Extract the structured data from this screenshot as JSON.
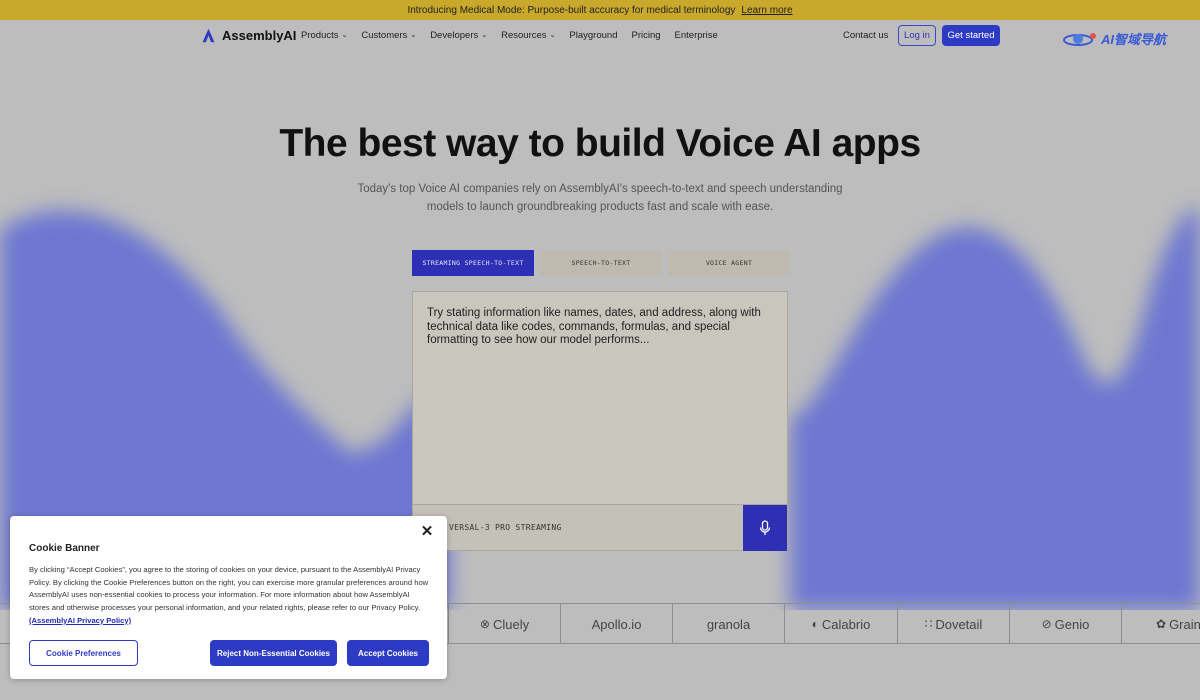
{
  "announcement": {
    "text": "Introducing Medical Mode: Purpose-built accuracy for medical terminology",
    "link": "Learn more"
  },
  "nav": {
    "brand": "AssemblyAI",
    "links": [
      "Products",
      "Customers",
      "Developers",
      "Resources",
      "Playground",
      "Pricing",
      "Enterprise"
    ],
    "contact": "Contact us",
    "login": "Log in",
    "cta": "Get started",
    "badge": "AI智域导航"
  },
  "hero": {
    "title": "The best way to build Voice AI apps",
    "subtitle_line1": "Today's top Voice AI companies rely on AssemblyAI's speech-to-text and speech understanding",
    "subtitle_line2": "models to launch groundbreaking products fast and scale with ease."
  },
  "tabs": [
    "STREAMING SPEECH-TO-TEXT",
    "SPEECH-TO-TEXT",
    "VOICE AGENT"
  ],
  "demo": {
    "prompt": "Try stating information like names, dates, and address, along with technical data like codes, commands, formulas, and special formatting to see how our model performs...",
    "model": "VERSAL-3 PRO STREAMING"
  },
  "logos": [
    "Cluely",
    "Apollo.io",
    "granola",
    "Calabrio",
    "Dovetail",
    "Genio",
    "Grain"
  ],
  "cookie": {
    "title": "Cookie Banner",
    "body": "By clicking “Accept Cookies”, you agree to the storing of cookies on your device, pursuant to the AssemblyAI Privacy Policy. By clicking the Cookie Preferences button on the right, you can exercise more granular preferences around how AssemblyAI uses non-essential cookies to process your information. For more information about how AssemblyAI stores and otherwise processes your personal information, and your related rights, please refer to our Privacy Policy.",
    "policy_link": "(AssemblyAI Privacy Policy)",
    "preferences": "Cookie Preferences",
    "reject": "Reject Non-Essential Cookies",
    "accept": "Accept Cookies"
  },
  "colors": {
    "brand": "#2d3bc4",
    "announce_bg": "#c9a92c",
    "wave": "#5a66d6"
  }
}
